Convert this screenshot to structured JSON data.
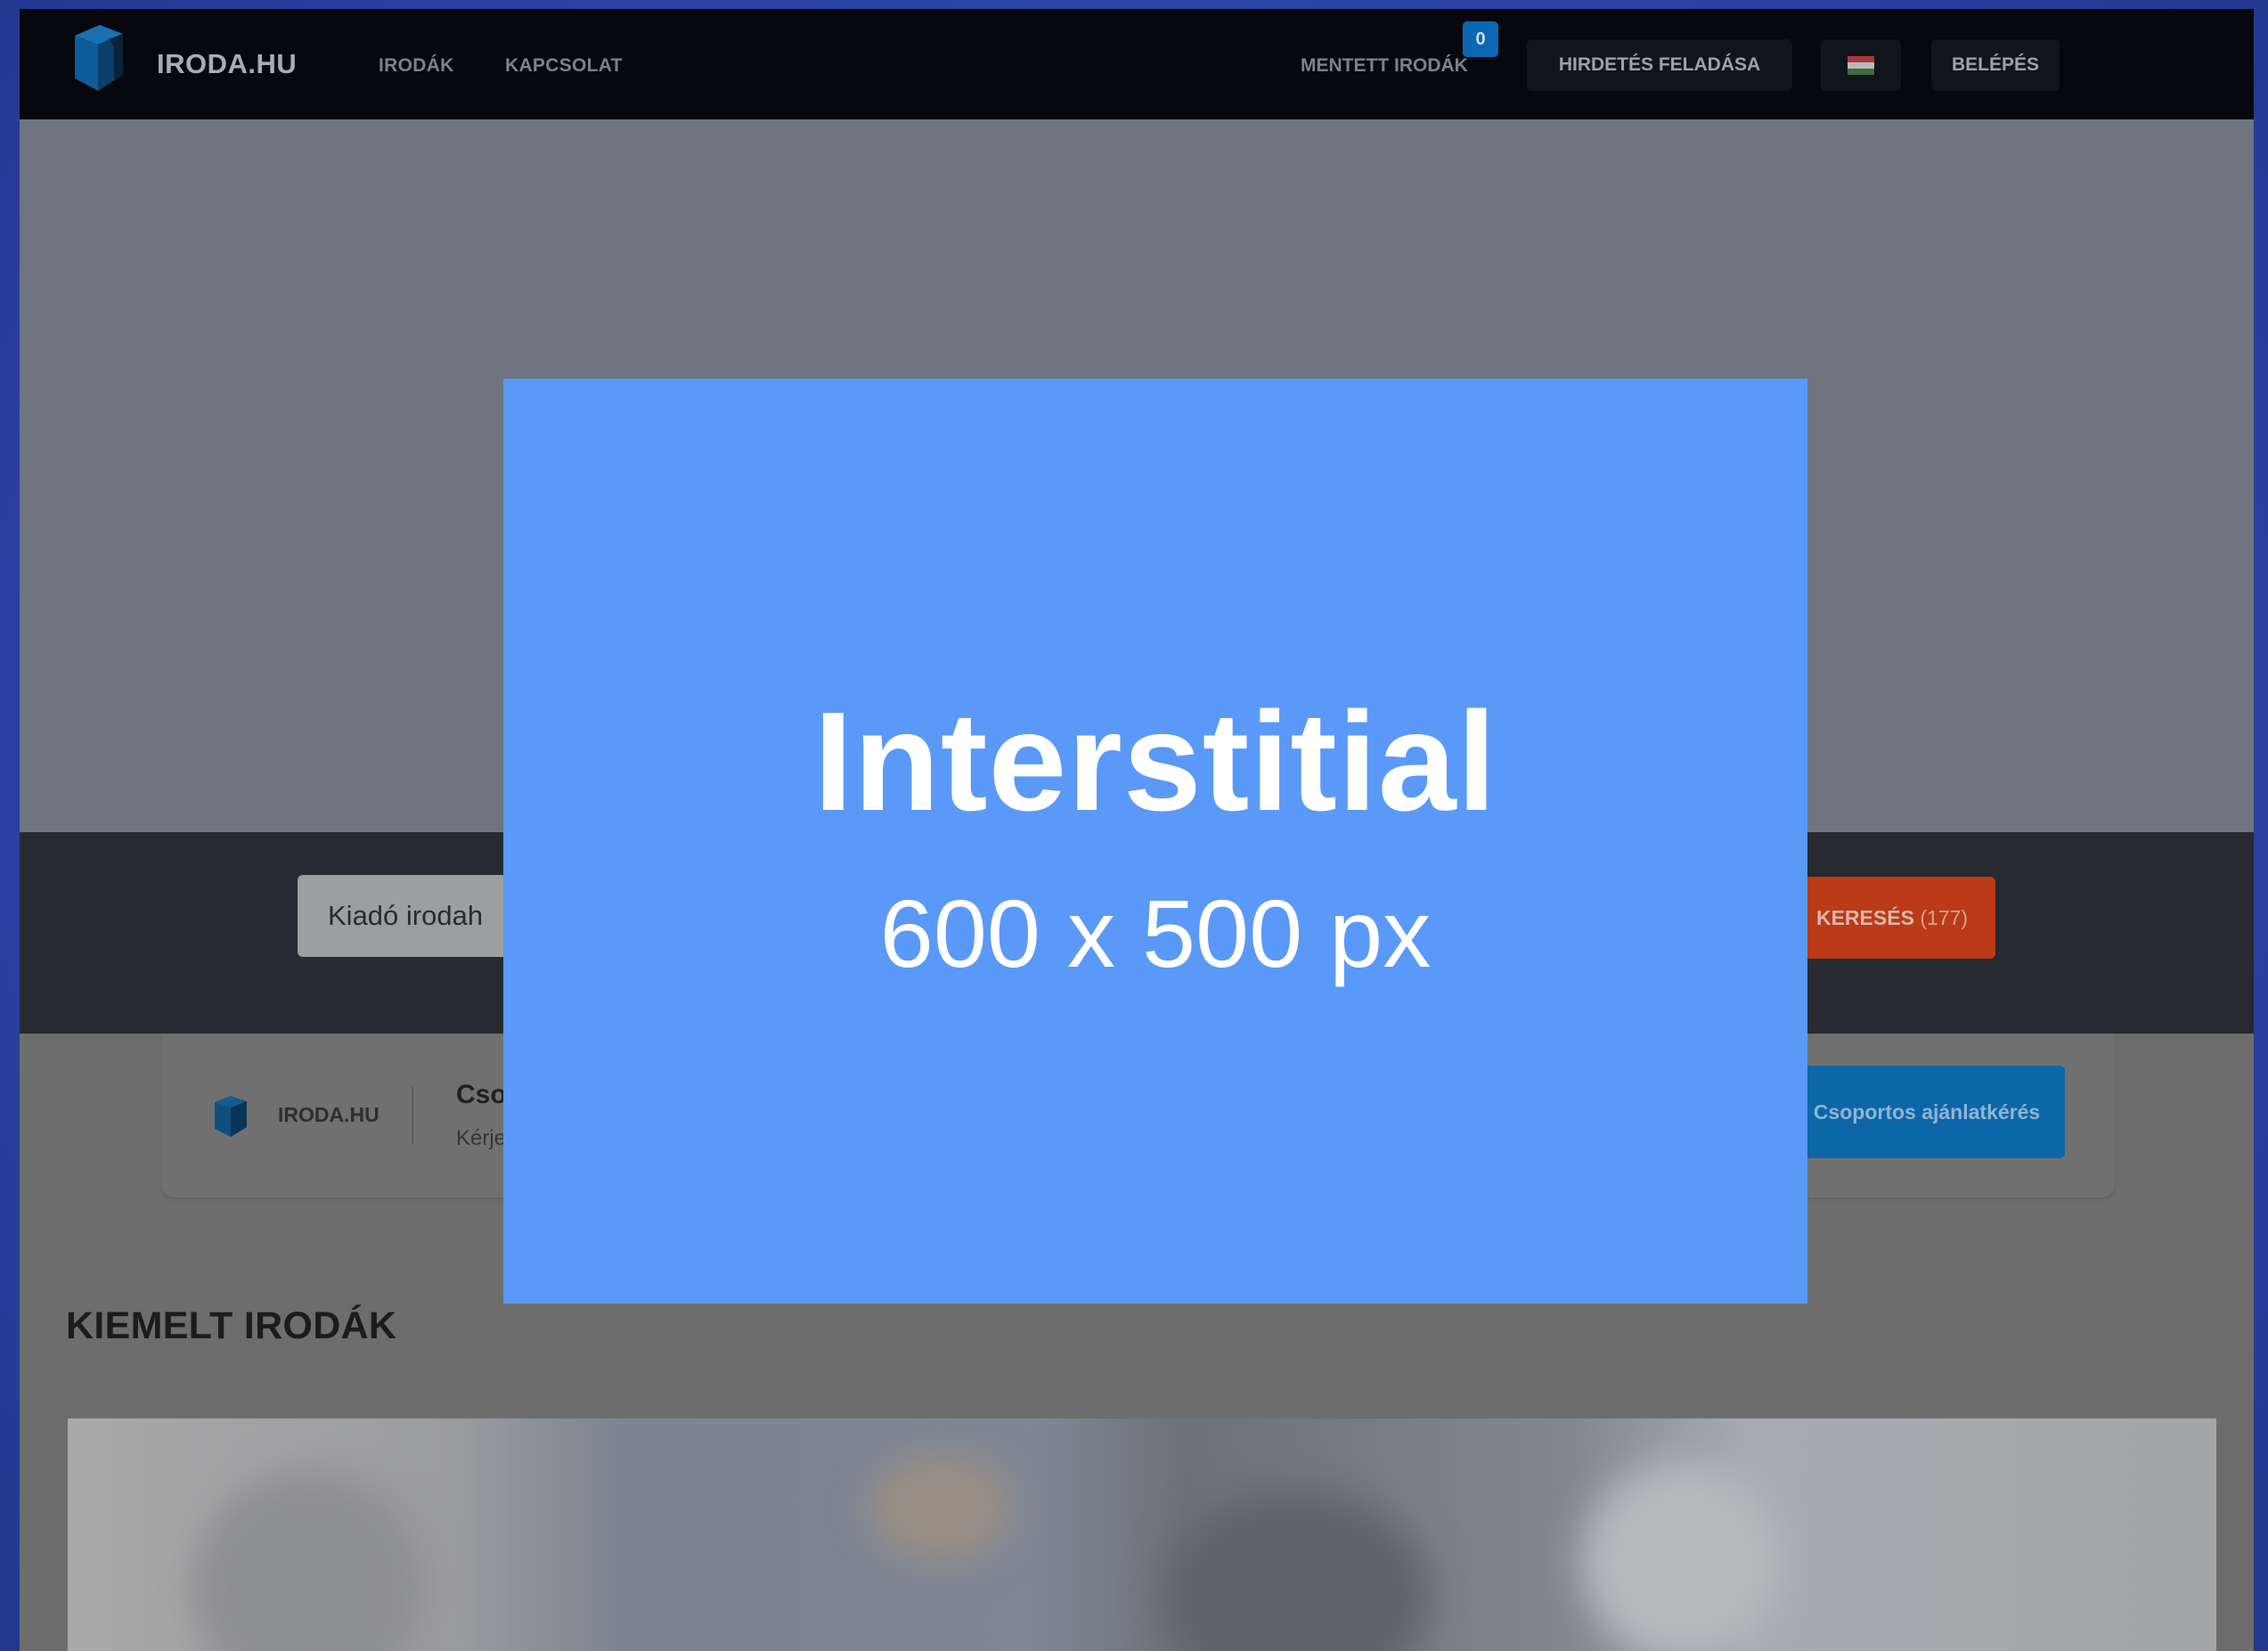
{
  "nav": {
    "logo_text": "IRODA.HU",
    "links": [
      "IRODÁK",
      "KAPCSOLAT"
    ],
    "saved_label": "MENTETT IRODÁK",
    "saved_count": "0",
    "post_ad_label": "HIRDETÉS FELADÁSA",
    "language_flag": "flag-hungary",
    "login_label": "BELÉPÉS"
  },
  "search": {
    "input_value": "Kiadó irodah",
    "button_label": "KERESÉS",
    "button_count": "(177)"
  },
  "group_offer": {
    "logo_text": "IRODA.HU",
    "title": "Cso",
    "subtitle": "Kérje",
    "button_label": "Csoportos ajánlatkérés"
  },
  "featured": {
    "title": "KIEMELT IRODÁK"
  },
  "ad": {
    "title": "Interstitial",
    "size": "600 x 500 px"
  },
  "colors": {
    "ad_background": "#5b99f8",
    "search_button": "#bb3a18",
    "primary_button": "#0d66a8",
    "navbar": "#06080d"
  }
}
